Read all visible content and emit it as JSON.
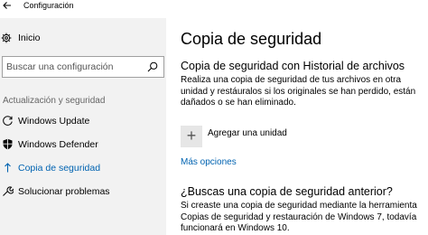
{
  "window": {
    "title": "Configuración"
  },
  "sidebar": {
    "home_label": "Inicio",
    "search_placeholder": "Buscar una configuración",
    "section_header": "Actualización y seguridad",
    "items": [
      {
        "label": "Windows Update",
        "icon": "refresh-icon",
        "active": false
      },
      {
        "label": "Windows Defender",
        "icon": "shield-icon",
        "active": false
      },
      {
        "label": "Copia de seguridad",
        "icon": "backup-arrow-icon",
        "active": true
      },
      {
        "label": "Solucionar problemas",
        "icon": "wrench-icon",
        "active": false
      }
    ]
  },
  "main": {
    "title": "Copia de seguridad",
    "history_section": {
      "title": "Copia de seguridad con Historial de archivos",
      "description": "Realiza una copia de seguridad de tus archivos en otra unidad y restáuralos si los originales se han perdido, están dañados o se han eliminado.",
      "add_drive_label": "Agregar una unidad",
      "more_options_label": "Más opciones"
    },
    "older_section": {
      "title": "¿Buscas una copia de seguridad anterior?",
      "description": "Si creaste una copia de seguridad mediante la herramienta Copias de seguridad y restauración de Windows 7, todavía funcionará en Windows 10."
    }
  },
  "colors": {
    "accent": "#0063b1",
    "sidebar_bg": "#f2f2f2"
  }
}
